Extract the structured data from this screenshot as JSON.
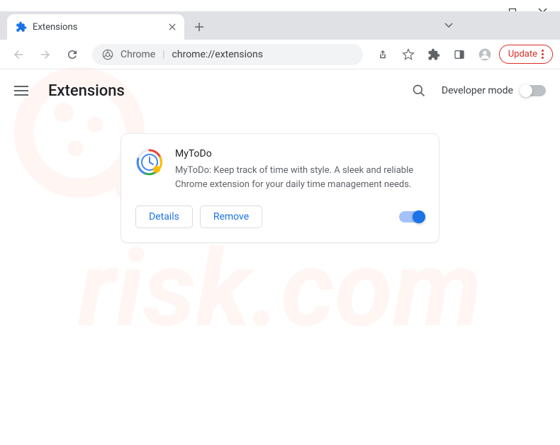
{
  "window": {
    "tab_title": "Extensions"
  },
  "toolbar": {
    "chrome_label": "Chrome",
    "url": "chrome://extensions",
    "update_label": "Update"
  },
  "page": {
    "title": "Extensions",
    "dev_mode_label": "Developer mode"
  },
  "extension": {
    "name": "MyToDo",
    "description": "MyToDo: Keep track of time with style. A sleek and reliable Chrome extension for your daily time management needs.",
    "details_label": "Details",
    "remove_label": "Remove",
    "enabled": true
  }
}
